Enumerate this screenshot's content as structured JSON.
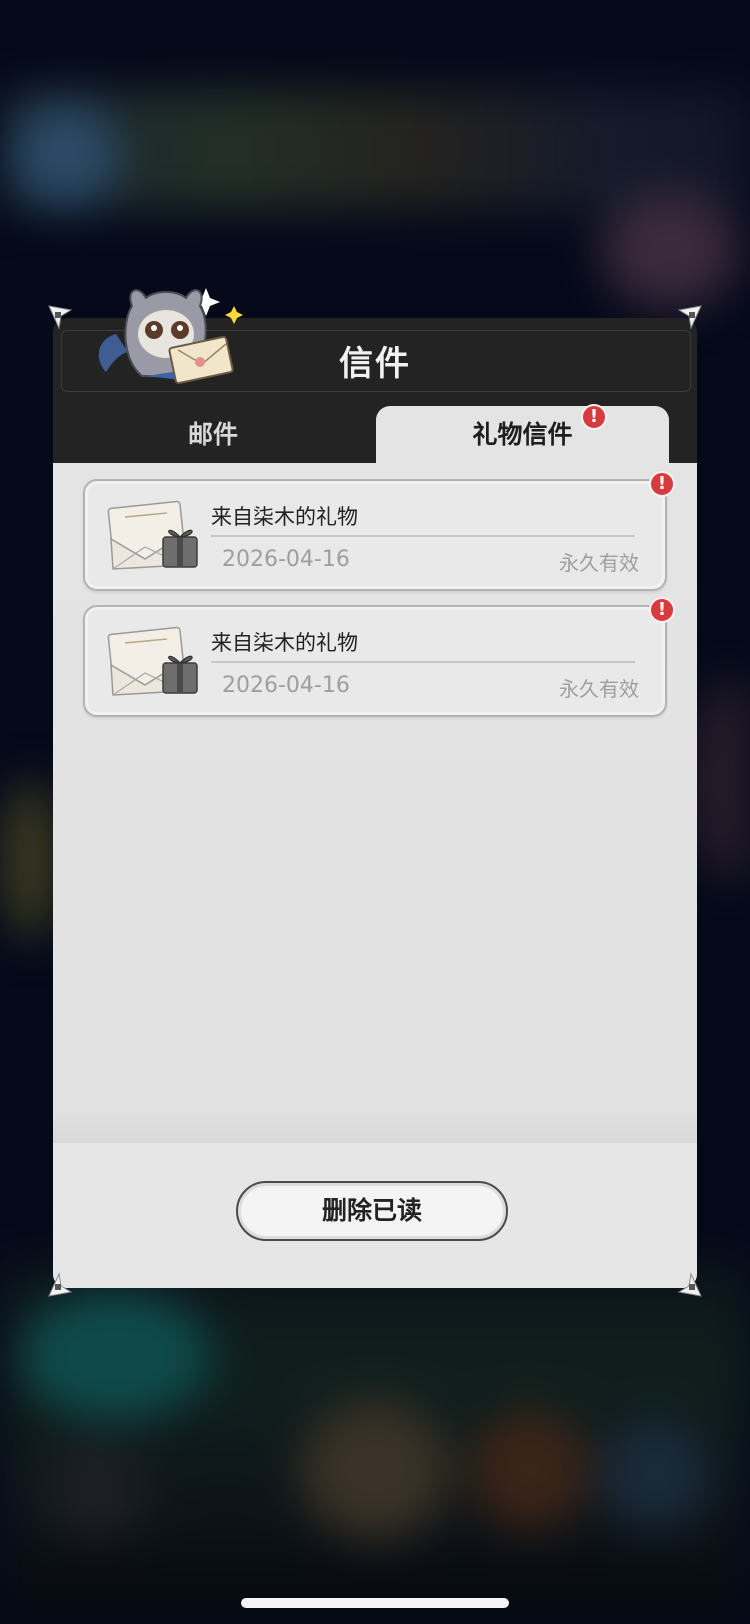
{
  "dialog": {
    "title": "信件",
    "tabs": [
      {
        "label": "邮件",
        "selected": false
      },
      {
        "label": "礼物信件",
        "selected": true,
        "badge": "!"
      }
    ],
    "mails": [
      {
        "title": "来自柒木的礼物",
        "date": "2026-04-16",
        "expiry": "永久有效",
        "badge": "!"
      },
      {
        "title": "来自柒木的礼物",
        "date": "2026-04-16",
        "expiry": "永久有效",
        "badge": "!"
      }
    ],
    "delete_label": "删除已读"
  },
  "colors": {
    "header": "#232323",
    "body": "#e2e2e2",
    "badge": "#d93a3e",
    "backdrop": "#05091a"
  },
  "icons": {
    "mascot": "owl-mascot-with-envelope",
    "mail": "envelope-with-gift-icon",
    "badge": "alert-badge-icon",
    "corner": "corner-ornament-icon"
  }
}
